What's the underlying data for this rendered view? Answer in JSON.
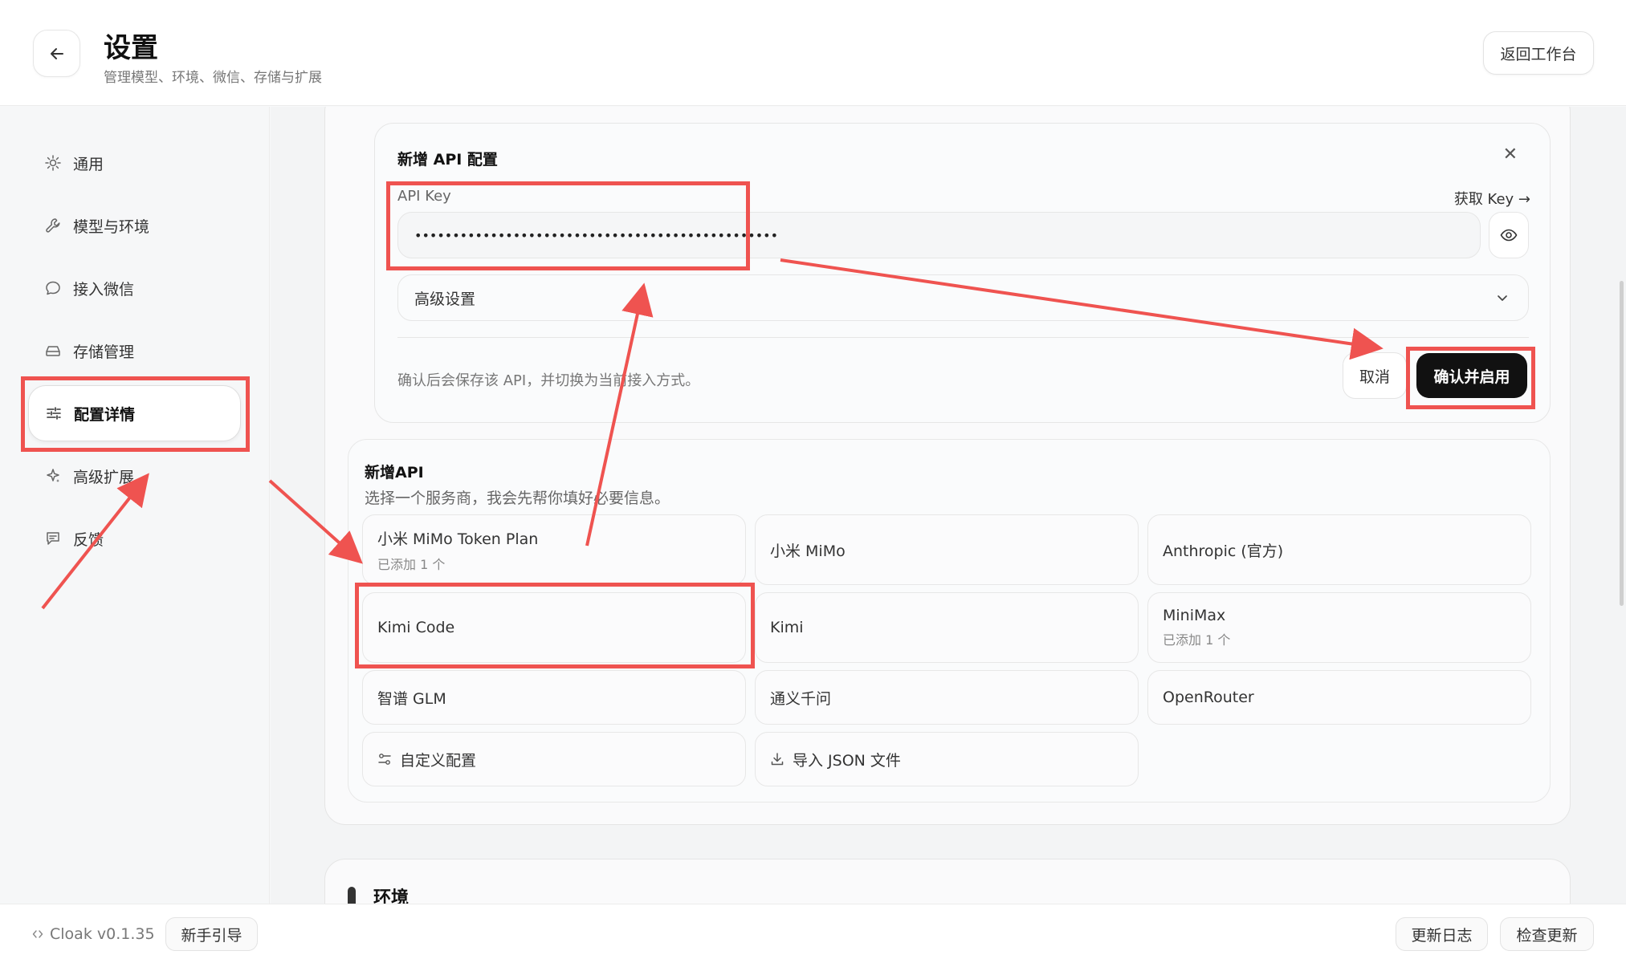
{
  "header": {
    "title": "设置",
    "subtitle": "管理模型、环境、微信、存储与扩展",
    "return_label": "返回工作台"
  },
  "sidebar": {
    "items": [
      {
        "label": "通用",
        "icon": "sun-icon"
      },
      {
        "label": "模型与环境",
        "icon": "wrench-icon"
      },
      {
        "label": "接入微信",
        "icon": "chat-bubble-icon"
      },
      {
        "label": "存储管理",
        "icon": "drive-icon"
      },
      {
        "label": "配置详情",
        "icon": "sliders-icon",
        "active": true
      },
      {
        "label": "高级扩展",
        "icon": "sparkle-icon"
      },
      {
        "label": "反馈",
        "icon": "message-icon"
      }
    ]
  },
  "api_form": {
    "title": "新增 API 配置",
    "key_label": "API Key",
    "get_key": "获取 Key →",
    "key_value": "••••••••••••••••••••••••••••••••••••••••••••••••",
    "advanced_label": "高级设置",
    "note": "确认后会保存该 API，并切换为当前接入方式。",
    "cancel_label": "取消",
    "confirm_label": "确认并启用"
  },
  "new_api": {
    "title": "新增API",
    "subtitle": "选择一个服务商，我会先帮你填好必要信息。",
    "providers": [
      {
        "name": "小米 MiMo Token Plan",
        "note": "已添加 1 个"
      },
      {
        "name": "小米 MiMo"
      },
      {
        "name": "Anthropic (官方)"
      },
      {
        "name": "Kimi Code"
      },
      {
        "name": "Kimi"
      },
      {
        "name": "MiniMax",
        "note": "已添加 1 个"
      },
      {
        "name": "智谱 GLM"
      },
      {
        "name": "通义千问"
      },
      {
        "name": "OpenRouter"
      },
      {
        "name": "自定义配置",
        "icon": "sliders-icon"
      },
      {
        "name": "导入 JSON 文件",
        "icon": "download-icon"
      }
    ]
  },
  "env": {
    "title": "环境"
  },
  "footer": {
    "version": "Cloak v0.1.35",
    "guide_label": "新手引导",
    "changelog_label": "更新日志",
    "check_update_label": "检查更新"
  },
  "colors": {
    "accent": "#111111",
    "annotation": "#ef5350"
  }
}
